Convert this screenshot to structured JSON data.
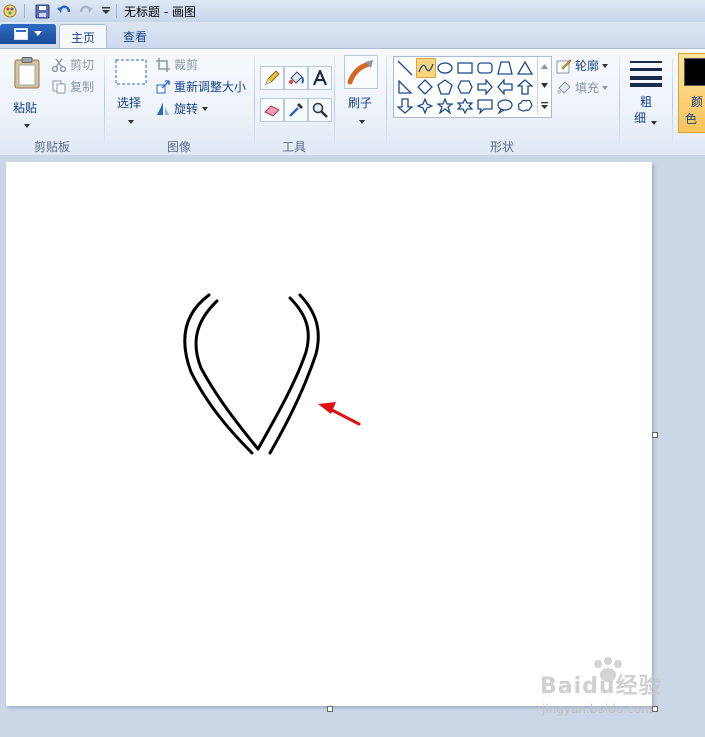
{
  "window": {
    "title": "无标题 - 画图"
  },
  "tabs": {
    "home": "主页",
    "view": "查看"
  },
  "clipboard": {
    "paste": "粘贴",
    "cut": "剪切",
    "copy": "复制",
    "group": "剪贴板"
  },
  "image": {
    "select": "选择",
    "crop": "裁剪",
    "resize": "重新调整大小",
    "rotate": "旋转",
    "group": "图像"
  },
  "tools": {
    "group": "工具"
  },
  "brushes": {
    "label": "刷子"
  },
  "shapes": {
    "outline": "轮廓",
    "fill": "填充",
    "group": "形状"
  },
  "size": {
    "line1": "粗",
    "line2": "细"
  },
  "colors": {
    "line1": "颜",
    "line2": "色"
  },
  "watermark": {
    "brand": "Baidu经验",
    "url": "jingyan.baidu.com"
  },
  "palette": {
    "accent": "#2f6bc1",
    "arrow": "#e01010",
    "selected_shape": "#fcd57c"
  }
}
